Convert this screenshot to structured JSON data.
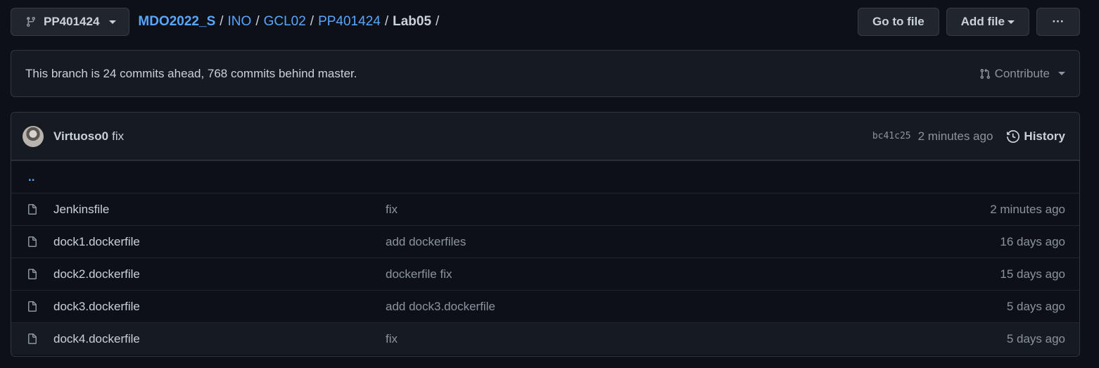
{
  "branch": {
    "name": "PP401424",
    "icon": "git-branch-icon"
  },
  "breadcrumb": {
    "parts": [
      "MDO2022_S",
      "INO",
      "GCL02",
      "PP401424"
    ],
    "current": "Lab05",
    "separator": "/"
  },
  "actions": {
    "go_to_file": "Go to file",
    "add_file": "Add file",
    "more": "···"
  },
  "notice": {
    "text": "This branch is 24 commits ahead, 768 commits behind master.",
    "contribute": "Contribute"
  },
  "latest_commit": {
    "author": "Virtuoso0",
    "message": "fix",
    "sha": "bc41c25",
    "age": "2 minutes ago",
    "history": "History"
  },
  "parent_dir": "..",
  "files": [
    {
      "name": "Jenkinsfile",
      "message": "fix",
      "age": "2 minutes ago"
    },
    {
      "name": "dock1.dockerfile",
      "message": "add dockerfiles",
      "age": "16 days ago"
    },
    {
      "name": "dock2.dockerfile",
      "message": "dockerfile fix",
      "age": "15 days ago"
    },
    {
      "name": "dock3.dockerfile",
      "message": "add dock3.dockerfile",
      "age": "5 days ago"
    },
    {
      "name": "dock4.dockerfile",
      "message": "fix",
      "age": "5 days ago"
    }
  ],
  "colors": {
    "background": "#0d1117",
    "link": "#58a6ff",
    "muted": "#8b949e",
    "border": "#30363d"
  }
}
